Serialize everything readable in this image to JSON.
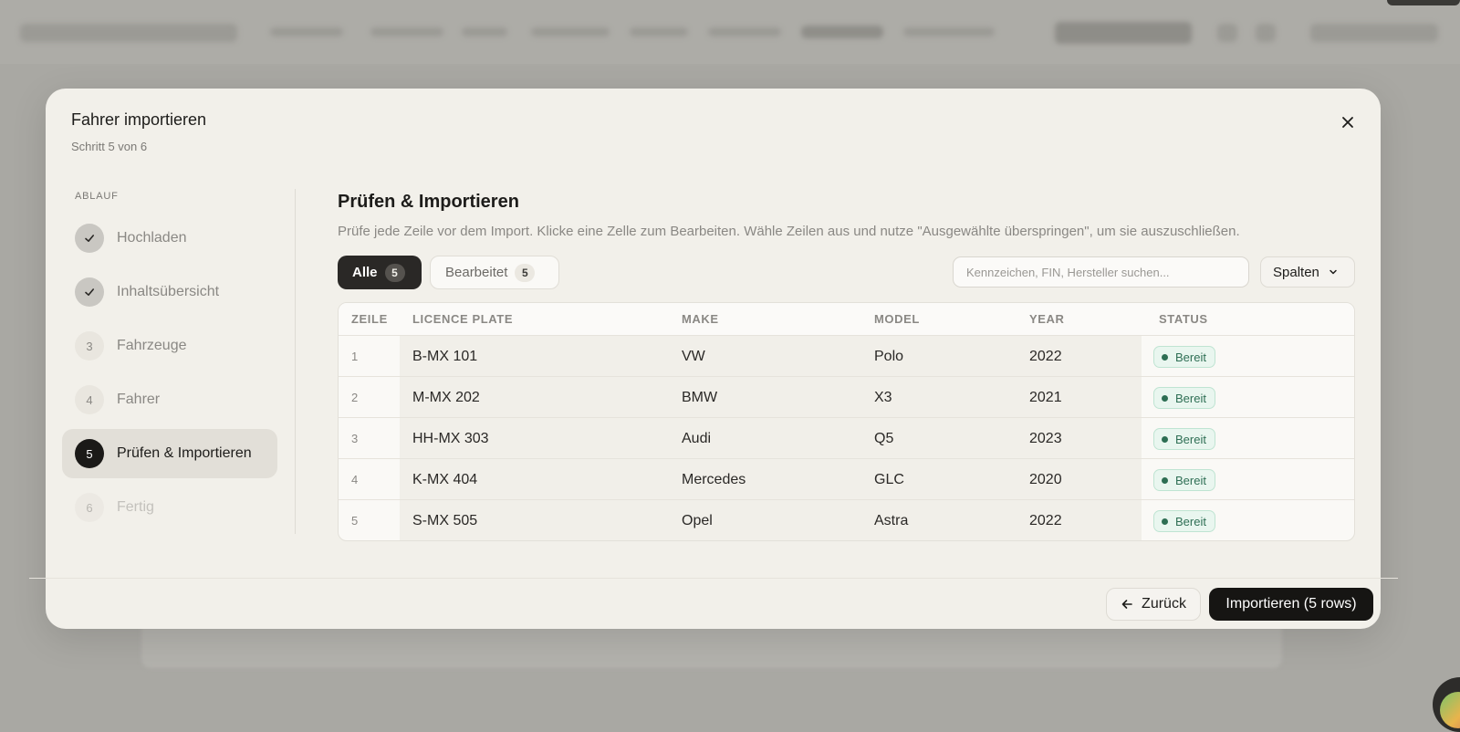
{
  "modal": {
    "title": "Fahrer importieren",
    "subtitle": "Schritt 5 von 6",
    "close_icon": "close-icon"
  },
  "sidebar": {
    "heading": "ABLAUF",
    "steps": [
      {
        "marker": "done",
        "label": "Hochladen",
        "state": "done"
      },
      {
        "marker": "done",
        "label": "Inhaltsübersicht",
        "state": "done"
      },
      {
        "marker": "3",
        "label": "Fahrzeuge",
        "state": "pending"
      },
      {
        "marker": "4",
        "label": "Fahrer",
        "state": "pending"
      },
      {
        "marker": "5",
        "label": "Prüfen & Importieren",
        "state": "active"
      },
      {
        "marker": "6",
        "label": "Fertig",
        "state": "future"
      }
    ]
  },
  "main": {
    "title": "Prüfen & Importieren",
    "description": "Prüfe jede Zeile vor dem Import. Klicke eine Zelle zum Bearbeiten. Wähle Zeilen aus und nutze \"Ausgewählte überspringen\", um sie auszuschließen.",
    "tabs": [
      {
        "label": "Alle",
        "count": "5"
      },
      {
        "label": "Bearbeitet",
        "count": "5"
      }
    ],
    "search": {
      "placeholder": "Kennzeichen, FIN, Hersteller suchen...",
      "value": ""
    },
    "columns_button": "Spalten"
  },
  "table": {
    "headers": [
      "ZEILE",
      "LICENCE PLATE",
      "MAKE",
      "MODEL",
      "YEAR",
      "STATUS"
    ],
    "rows": [
      {
        "row": "1",
        "plate": "B-MX 101",
        "make": "VW",
        "model": "Polo",
        "year": "2022",
        "status": "Bereit"
      },
      {
        "row": "2",
        "plate": "M-MX 202",
        "make": "BMW",
        "model": "X3",
        "year": "2021",
        "status": "Bereit"
      },
      {
        "row": "3",
        "plate": "HH-MX 303",
        "make": "Audi",
        "model": "Q5",
        "year": "2023",
        "status": "Bereit"
      },
      {
        "row": "4",
        "plate": "K-MX 404",
        "make": "Mercedes",
        "model": "GLC",
        "year": "2020",
        "status": "Bereit"
      },
      {
        "row": "5",
        "plate": "S-MX 505",
        "make": "Opel",
        "model": "Astra",
        "year": "2022",
        "status": "Bereit"
      }
    ]
  },
  "footer": {
    "back_label": "Zurück",
    "import_label": "Importieren (5 rows)"
  },
  "colors": {
    "accent": "#161513",
    "status_ready_bg": "#e9f6ef",
    "status_ready_text": "#2f6f55",
    "modal_bg": "#f2f0ea"
  }
}
